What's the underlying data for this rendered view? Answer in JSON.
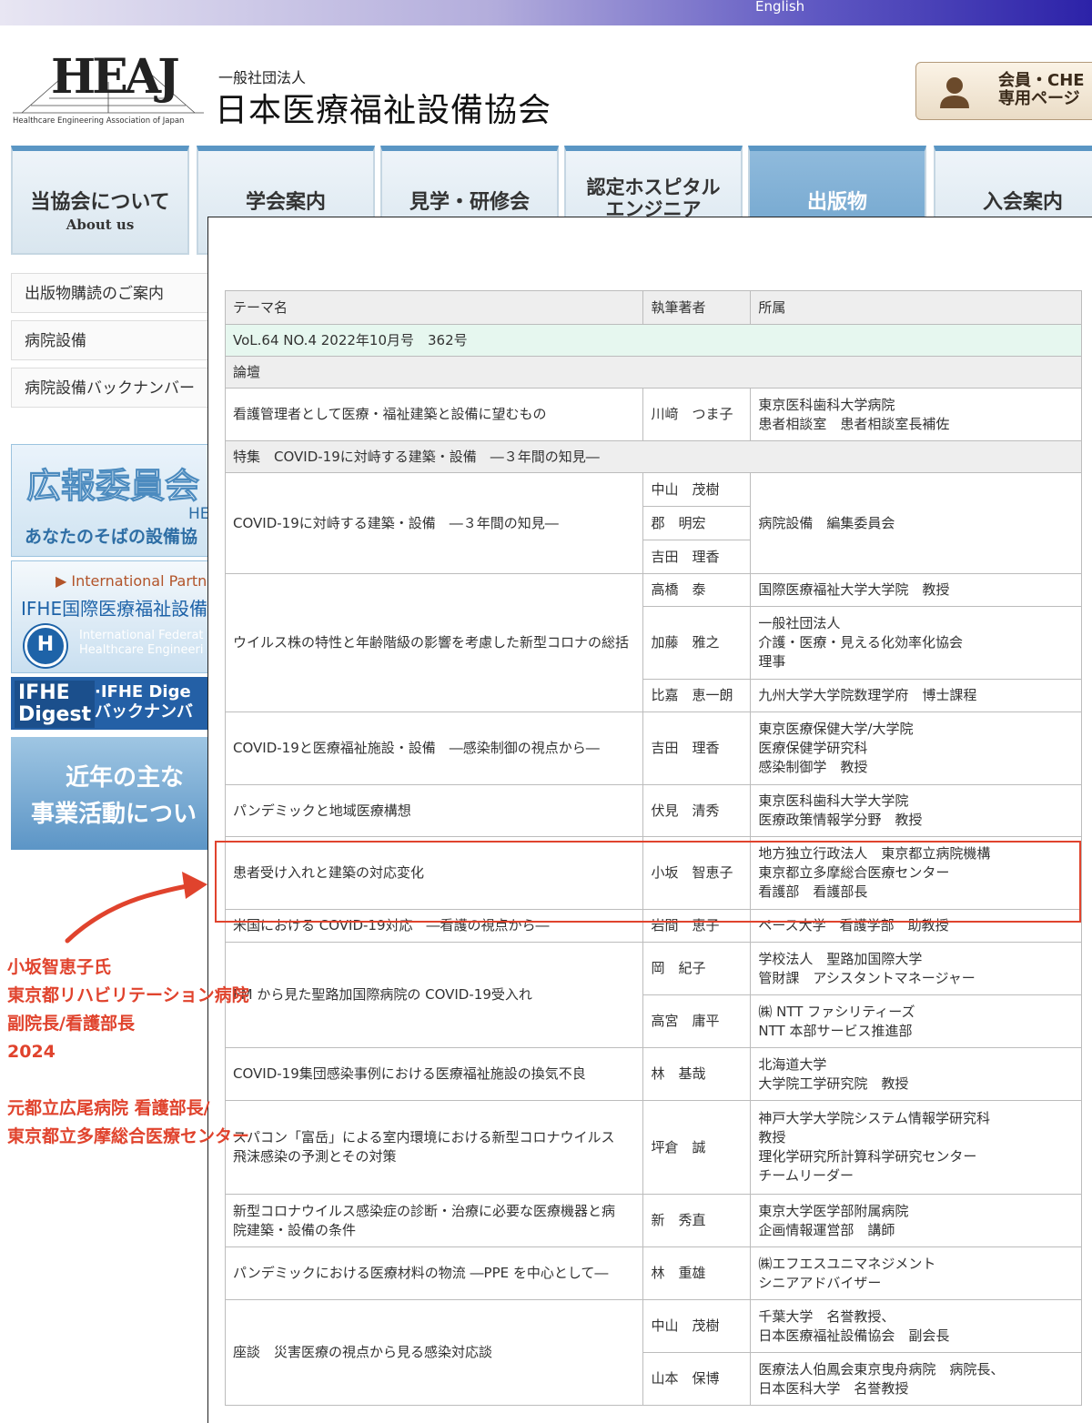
{
  "topbar": {
    "lang": "English"
  },
  "logo": {
    "mark": "HEAJ",
    "subtitle": "Healthcare Engineering Association of Japan"
  },
  "org": {
    "prefix": "一般社団法人",
    "name": "日本医療福祉設備協会"
  },
  "member_button": {
    "line1": "会員・CHE",
    "line2": "専用ページ"
  },
  "nav": {
    "tabs": [
      {
        "label": "当協会について",
        "sub": "About us"
      },
      {
        "label": "学会案内"
      },
      {
        "label": "見学・研修会"
      },
      {
        "label1": "認定ホスピタル",
        "label2": "エンジニア"
      },
      {
        "label": "出版物"
      },
      {
        "label": "入会案内"
      }
    ]
  },
  "sidebar": {
    "items": [
      {
        "label": "出版物購読のご案内"
      },
      {
        "label": "病院設備"
      },
      {
        "label": "病院設備バックナンバー"
      }
    ]
  },
  "banners": {
    "koho": {
      "big": "広報委員会",
      "mid": "HEA",
      "small": "あなたのそばの設備協"
    },
    "ifhe": {
      "l1": "▶ International Partner",
      "l2": "IFHE国際医療福祉設備",
      "logo": "H",
      "l3a": "International Federat",
      "l3b": "Healthcare Engineeri"
    },
    "digest": {
      "logo1": "IFHE",
      "logo2": "Digest",
      "t1": "·IFHE Dige",
      "t2": "バックナンバ"
    },
    "activity": {
      "t1": "近年の主な",
      "t2": "事業活動につい"
    }
  },
  "table": {
    "headers": [
      "テーマ名",
      "執筆著者",
      "所属"
    ],
    "volume": "VoL.64 NO.4 2022年10月号　362号",
    "sections": {
      "ronsetsu": "論壇",
      "tokushu": "特集　COVID-19に対峙する建築・設備　―３年間の知見―"
    },
    "rows": {
      "r1": {
        "theme": "看護管理者として医療・福祉建築と設備に望むもの",
        "author": "川﨑　つま子",
        "aff": [
          "東京医科歯科大学病院",
          "患者相談室　患者相談室長補佐"
        ]
      },
      "r2": {
        "theme": "COVID-19に対峙する建築・設備　―３年間の知見―",
        "authors": [
          "中山　茂樹",
          "郡　明宏",
          "吉田　理香"
        ],
        "aff": "病院設備　編集委員会"
      },
      "r3": {
        "theme": "ウイルス株の特性と年齢階級の影響を考慮した新型コロナの総括",
        "a1": "高橋　泰",
        "aff1": "国際医療福祉大学大学院　教授",
        "a2": "加藤　雅之",
        "aff2": [
          "一般社団法人",
          "介護・医療・見える化効率化協会",
          "理事"
        ],
        "a3": "比嘉　恵一朗",
        "aff3": "九州大学大学院数理学府　博士課程"
      },
      "r4": {
        "theme": "COVID-19と医療福祉施設・設備　―感染制御の視点から―",
        "author": "吉田　理香",
        "aff": [
          "東京医療保健大学/大学院",
          "医療保健学研究科",
          "感染制御学　教授"
        ]
      },
      "r5": {
        "theme": "パンデミックと地域医療構想",
        "author": "伏見　清秀",
        "aff": [
          "東京医科歯科大学大学院",
          "医療政策情報学分野　教授"
        ]
      },
      "r6": {
        "theme": "患者受け入れと建築の対応変化",
        "author": "小坂　智恵子",
        "aff": [
          "地方独立行政法人　東京都立病院機構",
          "東京都立多摩総合医療センター",
          "看護部　看護部長"
        ]
      },
      "r7": {
        "theme": "米国における COVID-19対応　―看護の視点から―",
        "author": "岩間　恵子",
        "aff": "ペース大学　看護学部　助教授"
      },
      "r8": {
        "theme": "FM から見た聖路加国際病院の COVID-19受入れ",
        "a1": "岡　紀子",
        "aff1": [
          "学校法人　聖路加国際大学",
          "管財課　アシスタントマネージャー"
        ],
        "a2": "高宮　庸平",
        "aff2": [
          "㈱ NTT ファシリティーズ",
          "NTT 本部サービス推進部"
        ]
      },
      "r9": {
        "theme": "COVID-19集団感染事例における医療福祉施設の換気不良",
        "author": "林　基哉",
        "aff": [
          "北海道大学",
          "大学院工学研究院　教授"
        ]
      },
      "r10": {
        "theme": [
          "スパコン「富岳」による室内環境における新型コロナウイルス",
          "飛沫感染の予測とその対策"
        ],
        "author": "坪倉　誠",
        "aff": [
          "神戸大学大学院システム情報学研究科",
          "教授",
          "理化学研究所計算科学研究センター",
          "チームリーダー"
        ]
      },
      "r11": {
        "theme": [
          "新型コロナウイルス感染症の診断・治療に必要な医療機器と病",
          "院建築・設備の条件"
        ],
        "author": "新　秀直",
        "aff": [
          "東京大学医学部附属病院",
          "企画情報運営部　講師"
        ]
      },
      "r12": {
        "theme": "パンデミックにおける医療材料の物流 ―PPE を中心として―",
        "author": "林　重雄",
        "aff": [
          "㈱エフエスユニマネジメント",
          "シニアアドバイザー"
        ]
      },
      "r13": {
        "theme": "座談　災害医療の視点から見る感染対応談",
        "a1": "中山　茂樹",
        "aff1": [
          "千葉大学　名誉教授、",
          "日本医療福祉設備協会　副会長"
        ],
        "a2": "山本　保博",
        "aff2": [
          "医療法人伯鳳会東京曳舟病院　病院長、",
          "日本医科大学　名誉教授"
        ]
      }
    }
  },
  "annotation": {
    "lines": [
      "小坂智恵子氏",
      "東京都リハビリテーション病院",
      "副院長/看護部長",
      "2024"
    ],
    "lines2": [
      "元都立広尾病院 看護部長/",
      "東京都立多摩総合医療センター"
    ],
    "color": "#e0432d"
  }
}
